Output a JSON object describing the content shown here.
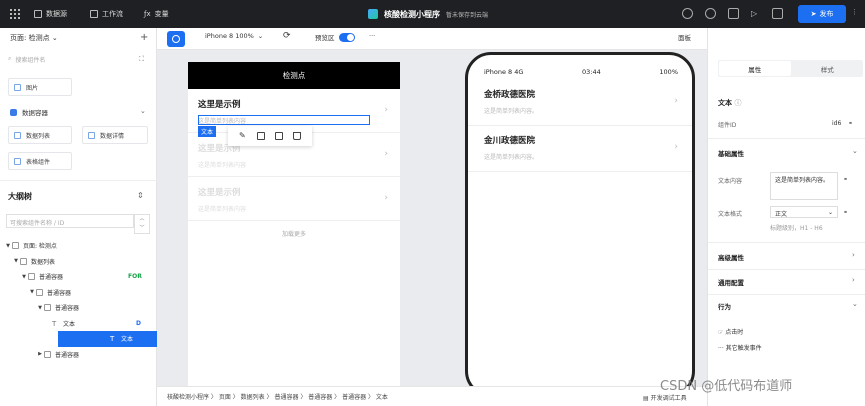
{
  "topbar": {
    "nav": [
      "数据源",
      "工作流",
      "变量"
    ],
    "app_name": "核酸检测小程序",
    "save_status": "暂未保存到云端",
    "publish_label": "发布"
  },
  "left": {
    "page_select": "页面: 检测点",
    "search_placeholder": "搜索组件名",
    "cards": [
      "图片",
      "数据列表",
      "数据详情",
      "表格组件"
    ],
    "group_title": "数据容器",
    "outline_title": "大纲树",
    "outline_search_placeholder": "可搜索组件名称 / ID",
    "tree": [
      {
        "label": "页面: 检测点",
        "tag": ""
      },
      {
        "label": "数据列表",
        "tag": ""
      },
      {
        "label": "普通容器",
        "tag": "FOR"
      },
      {
        "label": "普通容器",
        "tag": ""
      },
      {
        "label": "普通容器",
        "tag": ""
      },
      {
        "label": "文本",
        "tag": "D"
      },
      {
        "label": "文本",
        "tag": ""
      },
      {
        "label": "普通容器",
        "tag": ""
      }
    ]
  },
  "canvas": {
    "device": "iPhone 8 100%",
    "preview_label": "预览区",
    "panel_label": "面板",
    "page_header": "检测点",
    "items": [
      {
        "title": "这里是示例",
        "sub": "这是简单列表内容"
      },
      {
        "title": "这里是示例",
        "sub": "这是简单列表内容"
      },
      {
        "title": "这里是示例",
        "sub": "这是简单列表内容"
      }
    ],
    "selected_tag": "文本",
    "load_more": "加载更多"
  },
  "phone": {
    "carrier": "iPhone 8  4G",
    "time": "03:44",
    "battery": "100%",
    "items": [
      {
        "title": "金桥政德医院",
        "sub": "这是简单列表内容。"
      },
      {
        "title": "金川政德医院",
        "sub": "这是简单列表内容。"
      }
    ]
  },
  "breadcrumb": "核酸检测小程序 〉 页面 〉 数据列表 〉 普通容器 〉 普通容器 〉 普通容器 〉 文本",
  "debug_label": "开发调试工具",
  "right": {
    "tabs": [
      "属性",
      "样式"
    ],
    "component": "文本",
    "component_id_label": "组件ID",
    "component_id_value": "id6",
    "basic_props": "基础属性",
    "text_content_label": "文本内容",
    "text_content_value": "这是简单列表内容。",
    "text_format_label": "文本格式",
    "text_format_value": "正文",
    "title_hint": "标题级别，H1 - H6",
    "advanced": "高级属性",
    "general": "通用配置",
    "behavior": "行为",
    "event_click": "点击时",
    "event_other": "其它触发事件"
  },
  "watermark": "CSDN @低代码布道师",
  "colors": {
    "accent": "#1d6ff2",
    "topbar": "#1f2023"
  }
}
